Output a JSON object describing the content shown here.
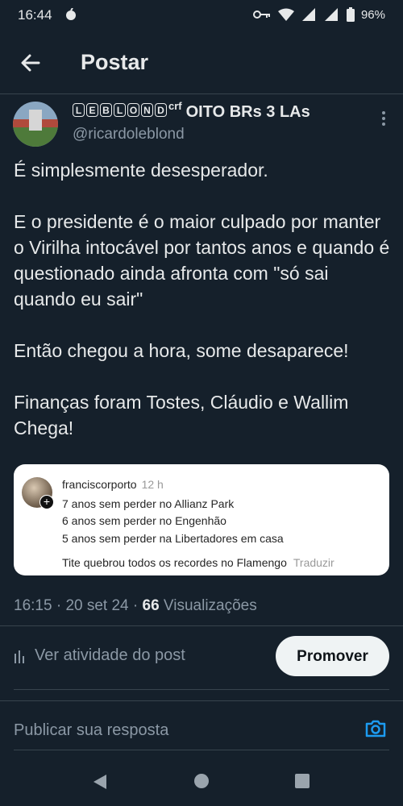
{
  "status": {
    "time": "16:44",
    "battery": "96%"
  },
  "header": {
    "title": "Postar"
  },
  "author": {
    "display_name_boxed": [
      "L",
      "E",
      "B",
      "L",
      "O",
      "N",
      "D"
    ],
    "display_name_sup": "crf",
    "display_name_rest": "OITO BRs 3 LAs",
    "handle": "@ricardoleblond"
  },
  "tweet": {
    "paragraphs": [
      "É simplesmente desesperador.",
      "E o presidente é o maior culpado por manter o Virilha intocável por tantos anos e quando é questionado ainda afronta com \"só sai quando eu sair\"",
      "Então chegou a hora, some desaparece!",
      "Finanças foram Tostes, Cláudio e Wallim Chega!"
    ]
  },
  "embed": {
    "username": "franciscorporto",
    "time": "12 h",
    "lines": [
      "7 anos sem perder no Allianz Park",
      "6 anos sem perder no Engenhão",
      "5 anos sem perder na Libertadores em casa"
    ],
    "last_line": "Tite quebrou todos os recordes no Flamengo",
    "translate": "Traduzir"
  },
  "meta": {
    "time": "16:15",
    "date": "20 set 24",
    "views_count": "66",
    "views_label": "Visualizações"
  },
  "actions": {
    "activity_label": "Ver atividade do post",
    "promote_label": "Promover"
  },
  "reply": {
    "placeholder": "Publicar sua resposta"
  },
  "colors": {
    "background": "#15202b",
    "accent": "#1d9bf0",
    "muted": "#8b98a5"
  }
}
